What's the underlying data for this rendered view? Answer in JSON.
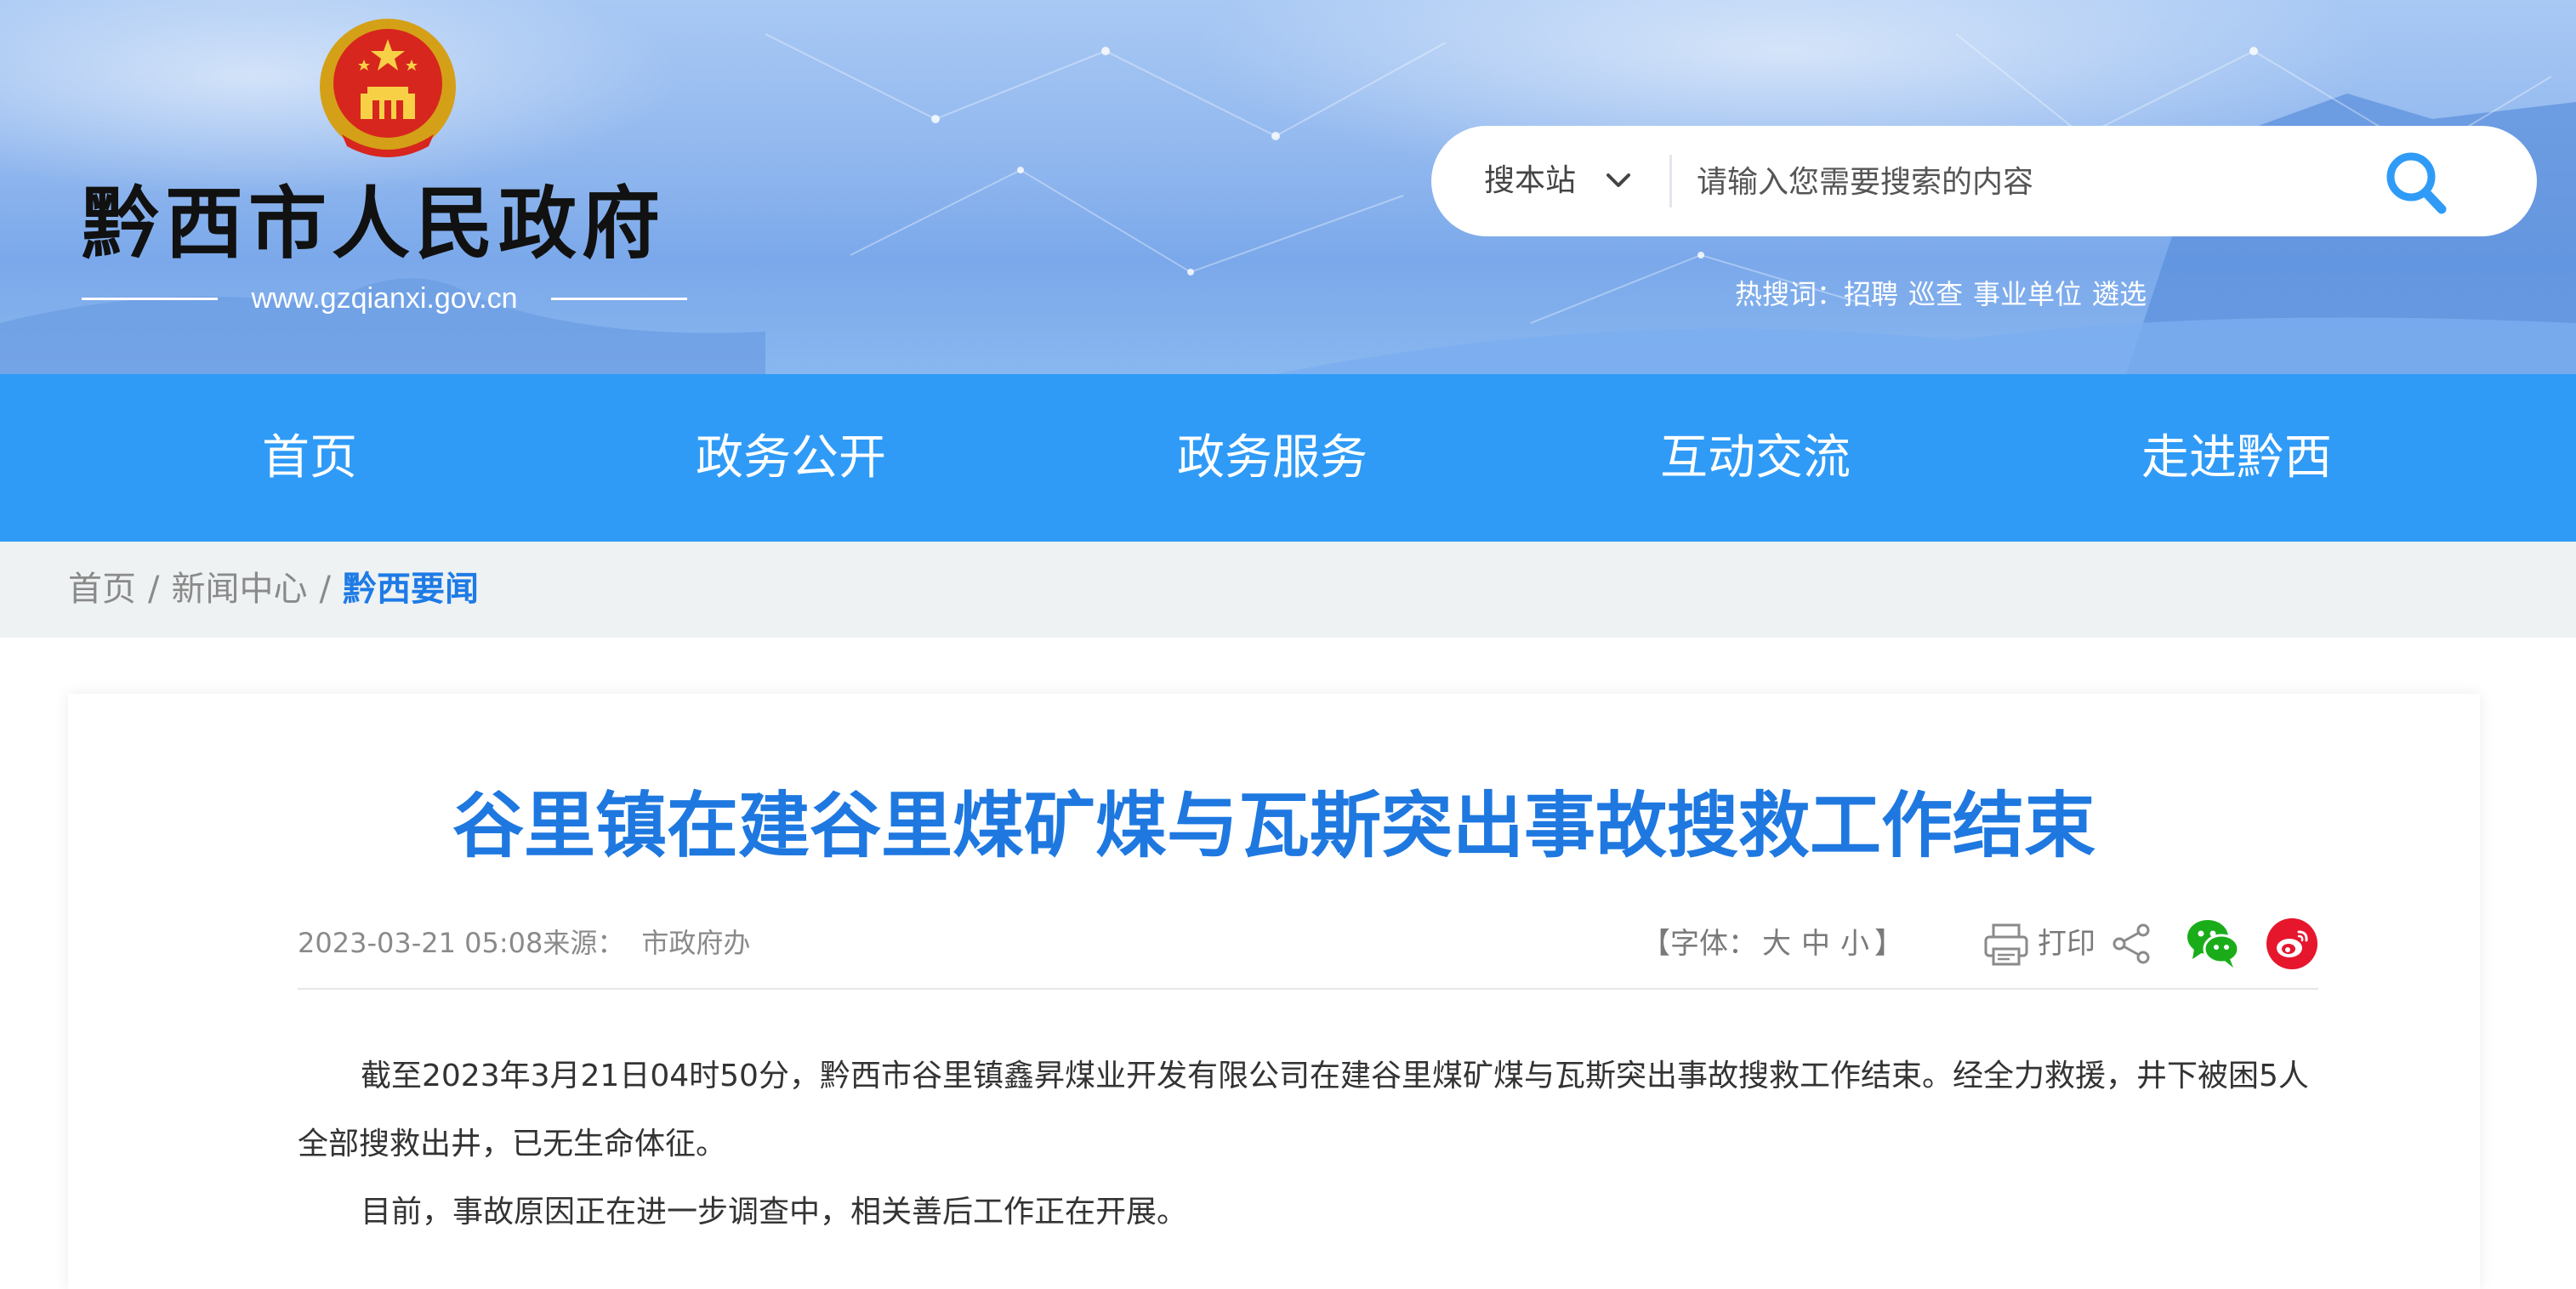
{
  "header": {
    "site_name": "黔西市人民政府",
    "site_url": "www.gzqianxi.gov.cn",
    "search": {
      "scope_label": "搜本站",
      "placeholder": "请输入您需要搜索的内容",
      "value": ""
    },
    "hot_search": {
      "label": "热搜词：",
      "terms": [
        "招聘",
        "巡查",
        "事业单位",
        "遴选"
      ]
    }
  },
  "nav": {
    "items": [
      {
        "label": "首页"
      },
      {
        "label": "政务公开"
      },
      {
        "label": "政务服务"
      },
      {
        "label": "互动交流"
      },
      {
        "label": "走进黔西"
      }
    ]
  },
  "breadcrumb": {
    "items": [
      "首页",
      "新闻中心",
      "黔西要闻"
    ],
    "separator": "/"
  },
  "article": {
    "title": "谷里镇在建谷里煤矿煤与瓦斯突出事故搜救工作结束",
    "datetime": "2023-03-21 05:08",
    "source_label": "来源：",
    "source": "市政府办",
    "font_label_open": "【字体：",
    "font_sizes": [
      "大",
      "中",
      "小"
    ],
    "font_label_close": "】",
    "print_label": "打印",
    "paragraphs": [
      "截至2023年3月21日04时50分，黔西市谷里镇鑫昇煤业开发有限公司在建谷里煤矿煤与瓦斯突出事故搜救工作结束。经全力救援，井下被困5人全部搜救出井，已无生命体征。",
      "目前，事故原因正在进一步调查中，相关善后工作正在开展。"
    ]
  },
  "colors": {
    "nav_bg": "#2f9bf7",
    "title_blue": "#1e78e0",
    "breadcrumb_current": "#1e7be6",
    "wechat_green": "#1aad19",
    "weibo_red": "#e6162d"
  },
  "icons": [
    "national-emblem-icon",
    "chevron-down-icon",
    "search-icon",
    "print-icon",
    "share-icon",
    "wechat-icon",
    "weibo-icon"
  ]
}
